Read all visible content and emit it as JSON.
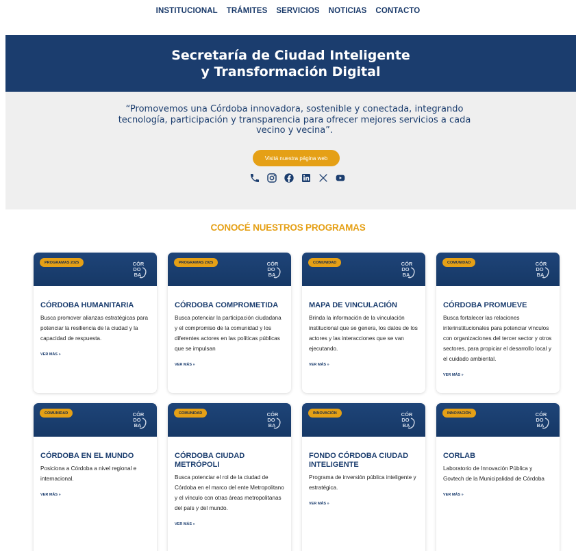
{
  "nav": {
    "items": [
      "INSTITUCIONAL",
      "TRÁMITES",
      "SERVICIOS",
      "NOTICIAS",
      "CONTACTO"
    ]
  },
  "hero": {
    "title_line1": "Secretaría de Ciudad Inteligente",
    "title_line2": "y Transformación Digital"
  },
  "mission": {
    "quote": "“Promovemos una Córdoba innovadora, sostenible y conectada, integrando tecnología, participación y transparencia para ofrecer mejores servicios a cada vecino y vecina”.",
    "cta_label": "Visitá nuestra página web"
  },
  "socials": {
    "icons": [
      "phone-icon",
      "instagram-icon",
      "facebook-icon",
      "linkedin-icon",
      "x-icon",
      "youtube-icon"
    ]
  },
  "programs": {
    "title": "CONOCÉ NUESTROS PROGRAMAS",
    "link_label": "VER MÁS »",
    "cards": [
      {
        "badge": "PROGRAMAS 2025",
        "title": "CÓRDOBA HUMANITARIA",
        "text": "Busca promover alianzas estratégicas para potenciar la resiliencia de la ciudad y la capacidad de respuesta."
      },
      {
        "badge": "PROGRAMAS 2025",
        "title": "CÓRDOBA COMPROMETIDA",
        "text": "Busca potenciar la participación ciudadana y el compromiso de la comunidad y los diferentes actores en las políticas públicas que se impulsan"
      },
      {
        "badge": "COMUNIDAD",
        "title": "MAPA DE VINCULACIÓN",
        "text": "Brinda la información de la vinculación institucional que se genera, los datos de los actores y las interacciones que se van ejecutando."
      },
      {
        "badge": "COMUNIDAD",
        "title": "CÓRDOBA PROMUEVE",
        "text": "Busca fortalecer las relaciones interinstitucionales para potenciar vínculos con organizaciones del tercer sector y otros sectores, para propiciar el desarrollo local y el cuidado ambiental."
      },
      {
        "badge": "COMUNIDAD",
        "title": "CÓRDOBA EN EL MUNDO",
        "text": "Posiciona a Córdoba a nivel regional e internacional."
      },
      {
        "badge": "COMUNIDAD",
        "title": "CÓRDOBA CIUDAD METRÓPOLI",
        "text": "Busca potenciar el rol de la ciudad de Córdoba en el marco del ente Metropolitano y el vínculo con otras áreas metropolitanas del país y del mundo."
      },
      {
        "badge": "INNOVACIÓN",
        "title": "FONDO CÓRDOBA CIUDAD INTELIGENTE",
        "text": "Programa de inversión pública inteligente y estratégica."
      },
      {
        "badge": "INNOVACIÓN",
        "title": "CORLAB",
        "text": "Laboratorio de Innovación Pública y Govtech de la Municipalidad de Córdoba"
      }
    ],
    "logo_text": [
      "CÓR",
      "DO",
      "BA"
    ]
  },
  "colors": {
    "navy": "#1b3d6e",
    "gold": "#e5a016",
    "light_gray": "#efefef"
  }
}
